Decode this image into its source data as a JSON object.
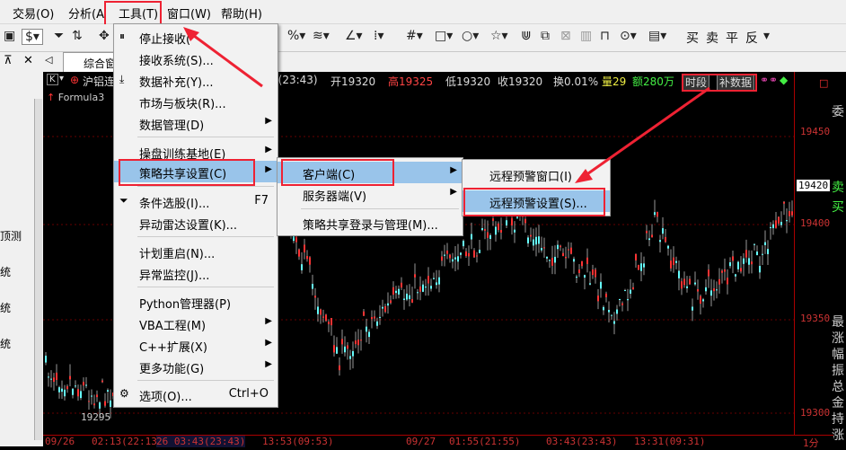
{
  "menubar": {
    "items": [
      "交易(O)",
      "分析(A",
      "工具(T)",
      "窗口(W)",
      "帮助(H)"
    ]
  },
  "toolbar": {
    "right_labels": [
      "买",
      "卖",
      "平",
      "反"
    ]
  },
  "tabbar": {
    "tab_label": "综合窗"
  },
  "chart_header": {
    "title": "沪铝连",
    "formula": "Formula3",
    "time": "3(23:43)",
    "open": "开19320",
    "high": "高19325",
    "low": "低19320",
    "close": "收19320",
    "turnover": "换0.01%",
    "volume": "量29",
    "amount": "额280万",
    "btn_time": "时段",
    "btn_fill": "补数据"
  },
  "left_panel": [
    "顶测",
    "统",
    "统",
    "统"
  ],
  "price_axis": {
    "labels": [
      "19450",
      "19420",
      "19400",
      "19350",
      "19300"
    ],
    "current": "19420",
    "low_marker": "19295"
  },
  "far_right": [
    "委",
    "卖",
    "买",
    "最",
    "涨",
    "幅",
    "振",
    "总",
    "金",
    "持",
    "涨"
  ],
  "x_axis": {
    "labels": [
      "09/26",
      "02:13(22:13)",
      "26 03:43(23:43)",
      "13:53(09:53)",
      "09/27",
      "01:55(21:55)",
      "03:43(23:43)",
      "13:31(09:31)",
      "1分"
    ]
  },
  "tools_menu": {
    "items": [
      {
        "label": "停止接收(",
        "icon": "pause-icon"
      },
      {
        "label": "接收系统(S)...",
        "icon": ""
      },
      {
        "label": "数据补充(Y)...",
        "icon": "download-icon"
      },
      {
        "label": "市场与板块(R)...",
        "icon": ""
      },
      {
        "label": "数据管理(D)",
        "icon": "",
        "submenu": true
      },
      {
        "label": "操盘训练基地(E)",
        "icon": "",
        "submenu": true
      },
      {
        "label": "策略共享设置(C)",
        "icon": "",
        "submenu": true
      },
      {
        "label": "条件选股(I)...",
        "icon": "filter-icon",
        "shortcut": "F7"
      },
      {
        "label": "异动雷达设置(K)...",
        "icon": ""
      },
      {
        "label": "计划重启(N)...",
        "icon": ""
      },
      {
        "label": "异常监控(J)...",
        "icon": ""
      },
      {
        "label": "Python管理器(P)",
        "icon": ""
      },
      {
        "label": "VBA工程(M)",
        "icon": "",
        "submenu": true
      },
      {
        "label": "C++扩展(X)",
        "icon": "",
        "submenu": true
      },
      {
        "label": "更多功能(G)",
        "icon": "",
        "submenu": true
      },
      {
        "label": "选项(O)...",
        "icon": "gear-icon",
        "shortcut": "Ctrl+O"
      }
    ]
  },
  "strategy_menu": {
    "items": [
      "客户端(C)",
      "服务器端(V)",
      "策略共享登录与管理(M)..."
    ]
  },
  "client_menu": {
    "items": [
      "远程预警窗口(I)",
      "远程预警设置(S)..."
    ]
  },
  "colors": {
    "up": "#ff3333",
    "down": "#66ffff",
    "highlight": "#99c4ea",
    "annotation": "#e22233"
  }
}
